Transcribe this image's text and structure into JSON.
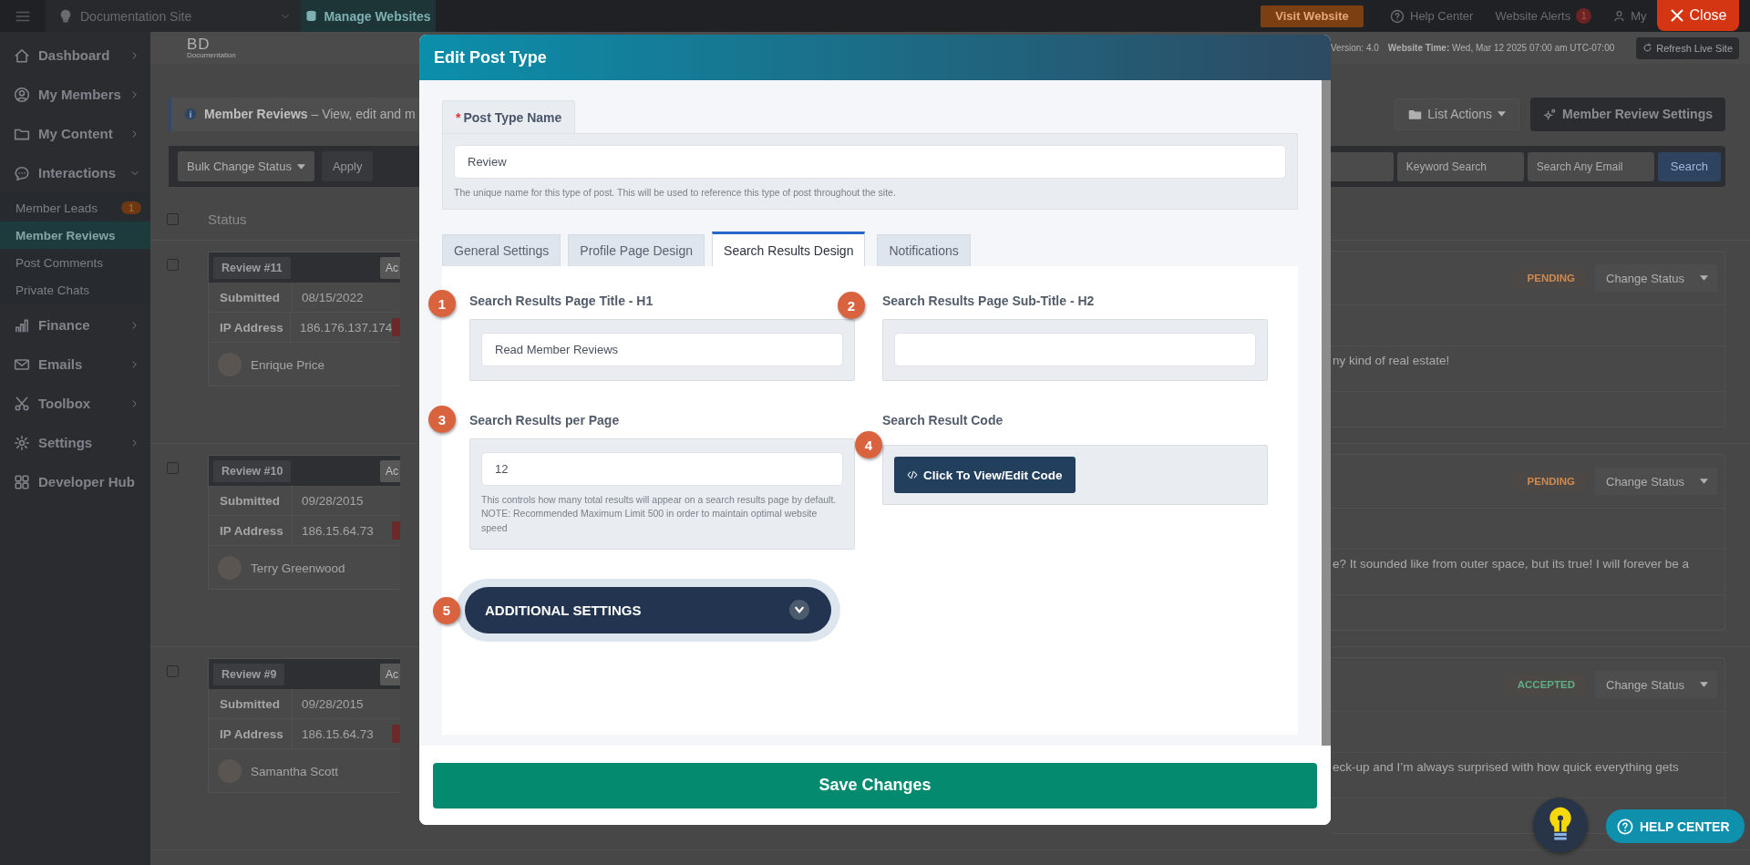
{
  "topbar": {
    "site": "Documentation Site",
    "manage": "Manage Websites",
    "visit": "Visit Website",
    "help": "Help Center",
    "alerts": "Website Alerts",
    "alerts_count": "1",
    "account": "My"
  },
  "close": "Close",
  "subbar": {
    "logo": "BD",
    "logo_caption": "Documentation",
    "version": "Version: 4.0",
    "time_label": "Website Time:",
    "time_value": "Wed, Mar 12 2025 07:00 am UTC-07:00",
    "refresh": "Refresh Live Site"
  },
  "sidebar": {
    "items": [
      {
        "label": "Dashboard",
        "expanded": false
      },
      {
        "label": "My Members",
        "expanded": false
      },
      {
        "label": "My Content",
        "expanded": false
      },
      {
        "label": "Interactions",
        "expanded": true,
        "children": [
          {
            "label": "Member Leads",
            "selected": false,
            "badge": "1"
          },
          {
            "label": "Member Reviews",
            "selected": true
          },
          {
            "label": "Post Comments",
            "selected": false
          },
          {
            "label": "Private Chats",
            "selected": false
          }
        ]
      },
      {
        "label": "Finance",
        "expanded": false
      },
      {
        "label": "Emails",
        "expanded": false
      },
      {
        "label": "Toolbox",
        "expanded": false
      },
      {
        "label": "Settings",
        "expanded": false
      },
      {
        "label": "Developer Hub"
      }
    ]
  },
  "page": {
    "alert_title": "Member Reviews",
    "alert_text": "– View, edit and m",
    "list_actions": "List Actions",
    "settings_button": "Member Review Settings",
    "bulk": "Bulk Change Status",
    "apply": "Apply",
    "filters": [
      {
        "placeholder": "Keyword Search"
      },
      {
        "placeholder": "Search Any Email"
      }
    ],
    "search": "Search",
    "status_header": "Status",
    "header_checked": false
  },
  "reviews": [
    {
      "title": "Review #11",
      "actions": "Ac",
      "checked": false,
      "submitted_label": "Submitted",
      "submitted": "08/15/2022",
      "ip_label": "IP Address",
      "ip": "186.176.137.174",
      "author": "Enrique Price",
      "status": "PENDING",
      "color": "#d08a50",
      "change": "Change Status",
      "excerpt": "ny kind of real estate!"
    },
    {
      "title": "Review #10",
      "actions": "Ac",
      "checked": false,
      "submitted_label": "Submitted",
      "submitted": "09/28/2015",
      "ip_label": "IP Address",
      "ip": "186.15.64.73",
      "author": "Terry Greenwood",
      "status": "PENDING",
      "color": "#d08a50",
      "change": "Change Status",
      "excerpt": "e? It sounded like from outer space, but its true! I will forever be a"
    },
    {
      "title": "Review #9",
      "actions": "Ac",
      "checked": false,
      "submitted_label": "Submitted",
      "submitted": "09/28/2015",
      "ip_label": "IP Address",
      "ip": "186.15.64.73",
      "author": "Samantha Scott",
      "status": "ACCEPTED",
      "color": "#5fae84",
      "change": "Change Status",
      "excerpt": "eck-up and I’m always surprised with how quick everything gets"
    }
  ],
  "modal": {
    "title": "Edit Post Type",
    "name_field": {
      "required_mark": "*",
      "label": "Post Type Name",
      "value": "Review",
      "help": "The unique name for this type of post. This will be used to reference this type of post throughout the site."
    },
    "tabs": [
      {
        "label": "General Settings",
        "selected": false
      },
      {
        "label": "Profile Page Design",
        "selected": false
      },
      {
        "label": "Search Results Design",
        "selected": true
      },
      {
        "label": "Notifications",
        "selected": false
      }
    ],
    "fields": [
      {
        "marker": "1",
        "label": "Search Results Page Title - H1",
        "kind": "text",
        "value": "Read Member Reviews"
      },
      {
        "marker": "2",
        "label": "Search Results Page Sub-Title - H2",
        "kind": "text"
      },
      {
        "marker": "3",
        "label": "Search Results per Page",
        "kind": "text",
        "value": "12",
        "help": "This controls how many total results will appear on a search results page by default. NOTE: Recommended Maximum Limit 500 in order to maintain optimal website speed"
      },
      {
        "marker": "4",
        "label": "Search Result Code",
        "kind": "code",
        "button": "Click To View/Edit Code"
      }
    ],
    "additional": {
      "marker": "5",
      "label": "ADDITIONAL SETTINGS",
      "expanded": false
    },
    "save": "Save Changes"
  },
  "help_center": "HELP CENTER"
}
